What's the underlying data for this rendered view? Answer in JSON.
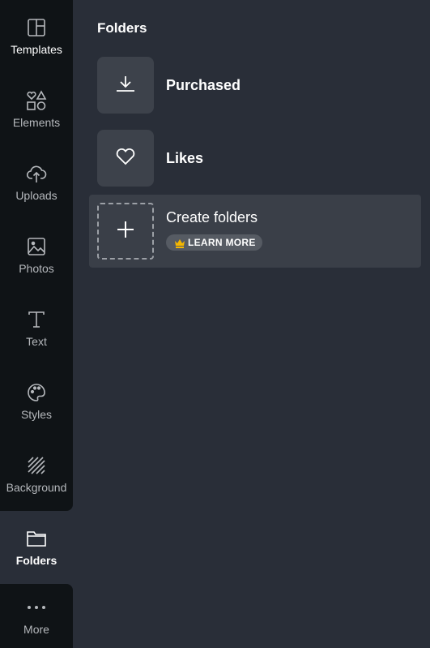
{
  "sidebar": {
    "items": [
      {
        "label": "Templates",
        "icon": "templates-icon",
        "active": false
      },
      {
        "label": "Elements",
        "icon": "elements-icon",
        "active": false
      },
      {
        "label": "Uploads",
        "icon": "upload-cloud-icon",
        "active": false
      },
      {
        "label": "Photos",
        "icon": "photo-icon",
        "active": false
      },
      {
        "label": "Text",
        "icon": "text-icon",
        "active": false
      },
      {
        "label": "Styles",
        "icon": "palette-icon",
        "active": false
      },
      {
        "label": "Background",
        "icon": "background-stripes-icon",
        "active": false
      },
      {
        "label": "Folders",
        "icon": "folder-icon",
        "active": true
      },
      {
        "label": "More",
        "icon": "more-dots-icon",
        "active": false
      }
    ]
  },
  "panel": {
    "title": "Folders",
    "folders": [
      {
        "label": "Purchased",
        "icon": "download-icon"
      },
      {
        "label": "Likes",
        "icon": "heart-icon"
      }
    ],
    "create": {
      "label": "Create folders",
      "badge_label": "LEARN MORE",
      "badge_icon": "crown-icon",
      "badge_icon_color": "#f5b700"
    }
  }
}
